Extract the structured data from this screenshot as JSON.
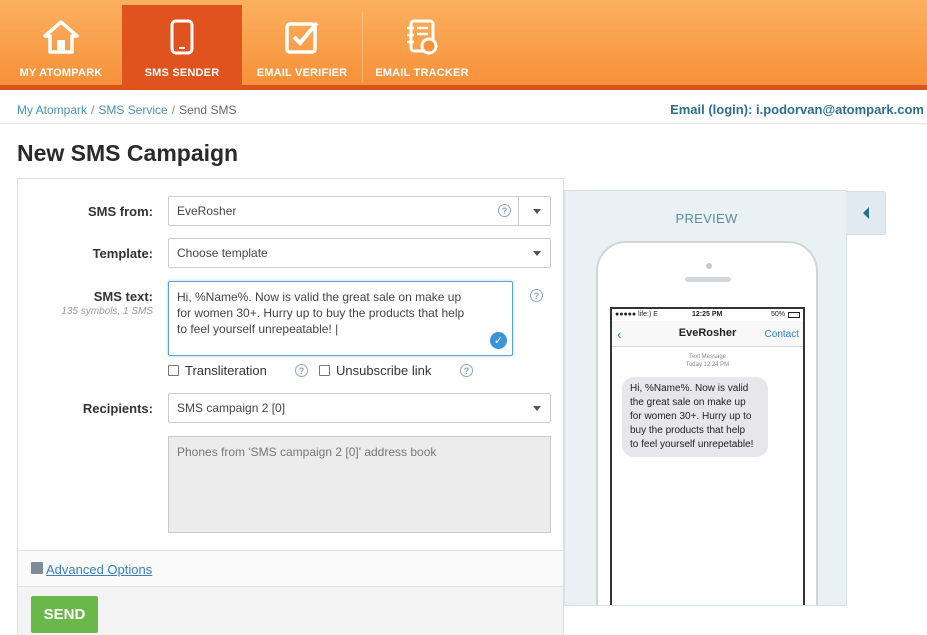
{
  "nav": {
    "items": [
      {
        "label": "MY ATOMPARK",
        "icon": "home-icon"
      },
      {
        "label": "SMS SENDER",
        "icon": "phone-icon",
        "active": true
      },
      {
        "label": "EMAIL VERIFIER",
        "icon": "checkbox-icon"
      },
      {
        "label": "EMAIL TRACKER",
        "icon": "notebook-icon"
      }
    ],
    "colors": {
      "bar": "#f7913a",
      "active": "#e0531e",
      "underline": "#d9531e"
    }
  },
  "breadcrumb": [
    "My Atompark",
    "SMS Service",
    "Send SMS"
  ],
  "account": {
    "login_text": "Email (login): i.podorvan@atompark.com"
  },
  "page_title": "New SMS Campaign",
  "form": {
    "sms_from": {
      "label": "SMS from:",
      "value": "EveRosher"
    },
    "template": {
      "label": "Template:",
      "value": "Choose template"
    },
    "sms_text": {
      "label": "SMS text:",
      "counter": "135 symbols, 1 SMS",
      "lines": [
        "Hi, %Name%. Now is valid the great sale on make up",
        "for women 30+. Hurry up to buy the products that help",
        "to feel yourself unrepeatable! |"
      ]
    },
    "transliteration": {
      "label": "Transliteration",
      "checked": false
    },
    "unsubscribe": {
      "label": "Unsubscribe link",
      "checked": false
    },
    "recipients": {
      "label": "Recipients:",
      "value": "SMS campaign 2 [0]"
    },
    "phones_placeholder": "Phones from 'SMS campaign 2 [0]' address book",
    "advanced_options": "Advanced Options",
    "send": "SEND",
    "help_glyph": "?"
  },
  "preview": {
    "title": "PREVIEW",
    "status": {
      "carrier": "●●●●● life:)  E",
      "time": "12:25 PM",
      "battery": "50%"
    },
    "sender": "EveRosher",
    "contact": "Contact",
    "back": "‹",
    "meta_line1": "Text Message",
    "meta_line2": "Today 12:24 PM",
    "message_lines": [
      "Hi, %Name%. Now is valid",
      "the great sale on make up",
      "for women 30+. Hurry up to",
      "buy the products that help",
      "to feel yourself unrepetable!"
    ]
  }
}
